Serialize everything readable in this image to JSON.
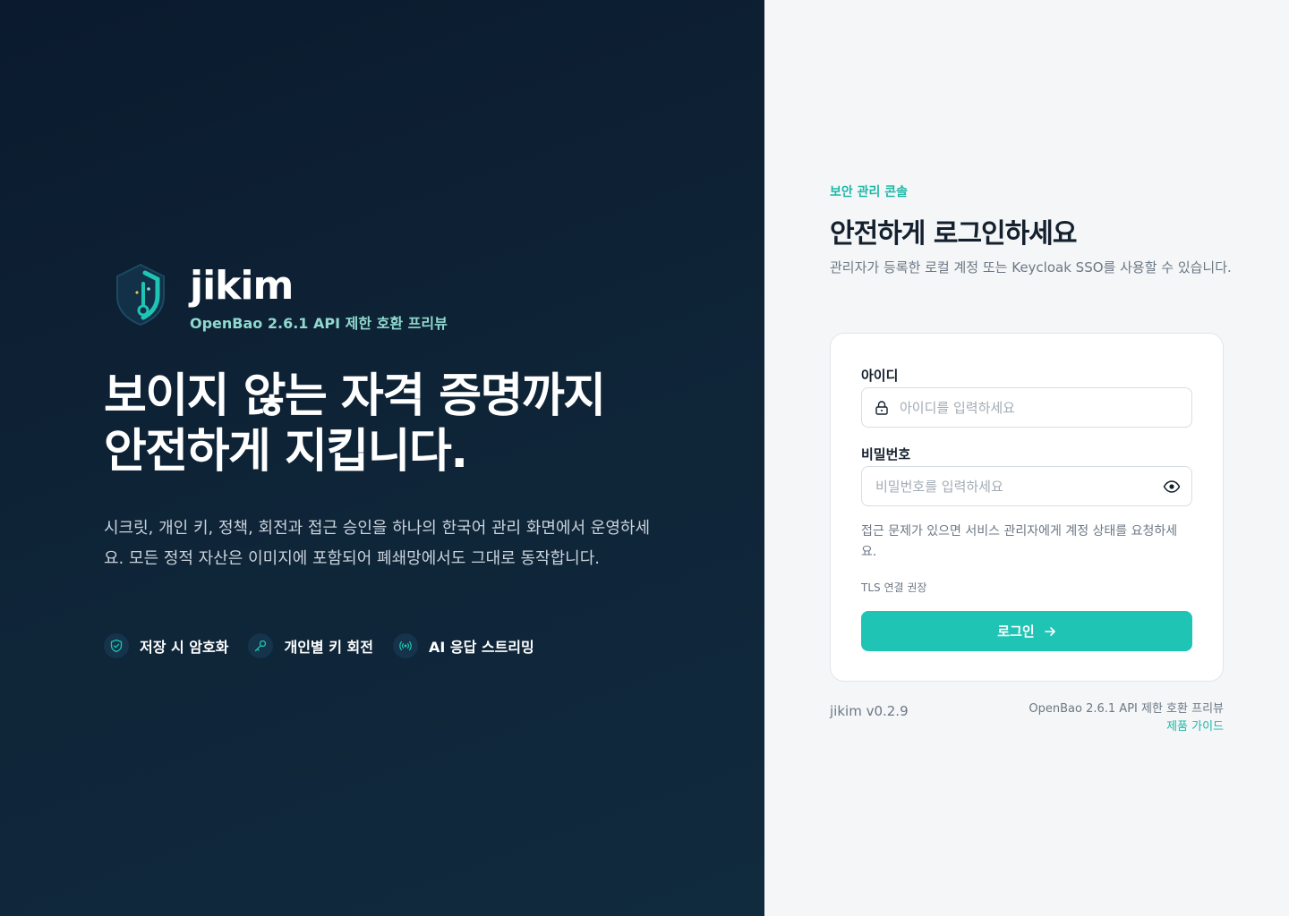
{
  "brand": {
    "name": "jikim",
    "subtitle": "OpenBao 2.6.1 API 제한 호환 프리뷰"
  },
  "hero": {
    "title_line1": "보이지 않는 자격 증명까지",
    "title_line2": "안전하게 지킵니다.",
    "description": "시크릿, 개인 키, 정책, 회전과 접근 승인을 하나의 한국어 관리 화면에서 운영하세요. 모든 정적 자산은 이미지에 포함되어 폐쇄망에서도 그대로 동작합니다."
  },
  "features": [
    {
      "label": "저장 시 암호화",
      "icon": "shield-check-icon"
    },
    {
      "label": "개인별 키 회전",
      "icon": "key-icon"
    },
    {
      "label": "AI 응답 스트리밍",
      "icon": "broadcast-icon"
    }
  ],
  "login": {
    "eyebrow": "보안 관리 콘솔",
    "title": "안전하게 로그인하세요",
    "description": "관리자가 등록한 로컬 계정 또는 Keycloak SSO를 사용할 수 있습니다.",
    "username_label": "아이디",
    "username_placeholder": "아이디를 입력하세요",
    "username_value": "",
    "password_label": "비밀번호",
    "password_placeholder": "비밀번호를 입력하세요",
    "password_value": "",
    "help_text": "접근 문제가 있으면 서비스 관리자에게 계정 상태를 요청하세요.",
    "tls_note": "TLS 연결 권장",
    "submit_label": "로그인"
  },
  "footer": {
    "version": "jikim v0.2.9",
    "compat": "OpenBao 2.6.1 API 제한 호환 프리뷰",
    "guide_link": "제품 가이드"
  },
  "colors": {
    "accent": "#1fc4b4",
    "accent_text": "#1fb8a8",
    "panel_dark": "#0b1a2e",
    "subtitle_mint": "#8fd9cf"
  }
}
